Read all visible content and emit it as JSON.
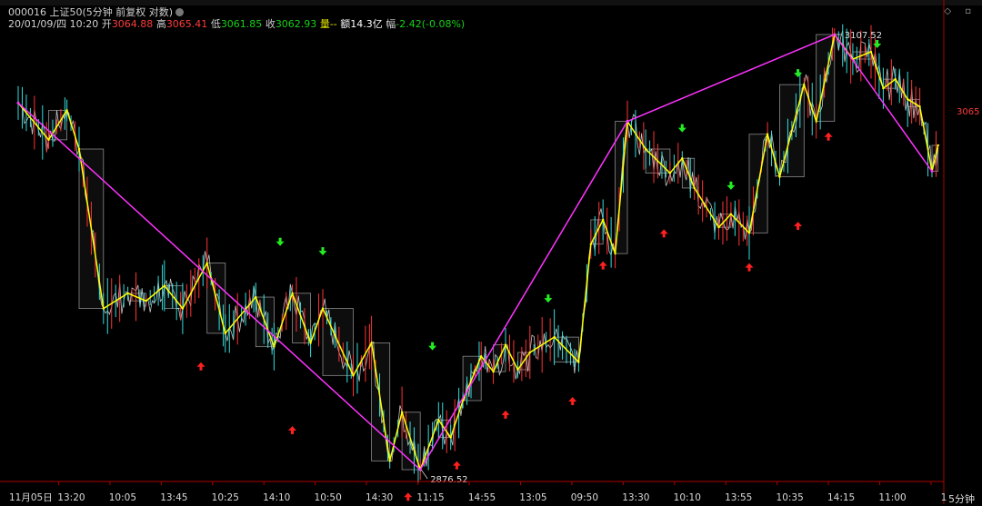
{
  "header": {
    "code": "000016",
    "name": "上证50",
    "mode": "(5分钟 前复权 对数)",
    "datetime": "20/01/09/四 10:20",
    "open_label": "开",
    "open": "3064.88",
    "high_label": "高",
    "high": "3065.41",
    "low_label": "低",
    "low": "3061.85",
    "close_label": "收",
    "close": "3062.93",
    "volume_label": "量",
    "volume": "--",
    "amount_label": "额",
    "amount": "14.3亿",
    "change_label": "幅",
    "change": "-2.42(-0.08%)"
  },
  "period_label": "5分钟",
  "colors": {
    "price_line": "#e8e8e8",
    "zigzag_small": "#ffff00",
    "zigzag_large": "#ff33ff",
    "up_arrow": "#ff2020",
    "down_arrow": "#22ee22",
    "box": "#8a8a8a"
  },
  "chart_data": {
    "type": "line",
    "x_tick_labels": [
      "11月05日",
      "13:20",
      "10:05",
      "13:45",
      "10:25",
      "14:10",
      "10:50",
      "14:30",
      "11:15",
      "14:55",
      "13:05",
      "09:50",
      "13:30",
      "10:10",
      "13:55",
      "10:35",
      "14:15",
      "11:00",
      "1"
    ],
    "price_scale": {
      "max": 3107.52,
      "min": 2876.52,
      "log": true
    },
    "current_price_label": "3065",
    "annotations": [
      {
        "label": "3107.52",
        "kind": "high"
      },
      {
        "label": "2876.52",
        "kind": "low"
      }
    ],
    "large_zigzag": [
      {
        "i": 0,
        "p": 3070
      },
      {
        "i": 66,
        "p": 2876.52
      },
      {
        "i": 100,
        "p": 3060
      },
      {
        "i": 134,
        "p": 3107.52
      },
      {
        "i": 150,
        "p": 3033
      }
    ],
    "small_zigzag": [
      {
        "i": 0,
        "p": 3070
      },
      {
        "i": 5,
        "p": 3050
      },
      {
        "i": 8,
        "p": 3066
      },
      {
        "i": 10,
        "p": 3045
      },
      {
        "i": 14,
        "p": 2960
      },
      {
        "i": 18,
        "p": 2968
      },
      {
        "i": 21,
        "p": 2964
      },
      {
        "i": 24,
        "p": 2972
      },
      {
        "i": 27,
        "p": 2960
      },
      {
        "i": 31,
        "p": 2984
      },
      {
        "i": 34,
        "p": 2947
      },
      {
        "i": 39,
        "p": 2966
      },
      {
        "i": 42,
        "p": 2940
      },
      {
        "i": 45,
        "p": 2968
      },
      {
        "i": 48,
        "p": 2942
      },
      {
        "i": 50,
        "p": 2960
      },
      {
        "i": 55,
        "p": 2925
      },
      {
        "i": 58,
        "p": 2942
      },
      {
        "i": 61,
        "p": 2881
      },
      {
        "i": 63,
        "p": 2906
      },
      {
        "i": 66,
        "p": 2876.52
      },
      {
        "i": 69,
        "p": 2902
      },
      {
        "i": 71,
        "p": 2893
      },
      {
        "i": 73,
        "p": 2912
      },
      {
        "i": 76,
        "p": 2935
      },
      {
        "i": 78,
        "p": 2927
      },
      {
        "i": 80,
        "p": 2941
      },
      {
        "i": 82,
        "p": 2928
      },
      {
        "i": 84,
        "p": 2937
      },
      {
        "i": 88,
        "p": 2945
      },
      {
        "i": 92,
        "p": 2932
      },
      {
        "i": 94,
        "p": 2994
      },
      {
        "i": 96,
        "p": 3007
      },
      {
        "i": 98,
        "p": 2989
      },
      {
        "i": 100,
        "p": 3060
      },
      {
        "i": 103,
        "p": 3045
      },
      {
        "i": 107,
        "p": 3032
      },
      {
        "i": 109,
        "p": 3040
      },
      {
        "i": 111,
        "p": 3024
      },
      {
        "i": 115,
        "p": 3003
      },
      {
        "i": 117,
        "p": 3010
      },
      {
        "i": 120,
        "p": 3000
      },
      {
        "i": 123,
        "p": 3053
      },
      {
        "i": 125,
        "p": 3030
      },
      {
        "i": 129,
        "p": 3080
      },
      {
        "i": 131,
        "p": 3060
      },
      {
        "i": 134,
        "p": 3107.52
      },
      {
        "i": 137,
        "p": 3094
      },
      {
        "i": 140,
        "p": 3098
      },
      {
        "i": 142,
        "p": 3078
      },
      {
        "i": 144,
        "p": 3083
      },
      {
        "i": 146,
        "p": 3072
      },
      {
        "i": 148,
        "p": 3068
      },
      {
        "i": 150,
        "p": 3033
      },
      {
        "i": 151,
        "p": 3047
      }
    ],
    "down_signals": [
      {
        "i": 43,
        "p": 2995
      },
      {
        "i": 50,
        "p": 2990
      },
      {
        "i": 68,
        "p": 2940
      },
      {
        "i": 87,
        "p": 2965
      },
      {
        "i": 109,
        "p": 3056
      },
      {
        "i": 117,
        "p": 3025
      },
      {
        "i": 128,
        "p": 3086
      },
      {
        "i": 141,
        "p": 3102
      }
    ],
    "up_signals": [
      {
        "i": 30,
        "p": 2930
      },
      {
        "i": 45,
        "p": 2897
      },
      {
        "i": 64,
        "p": 2863
      },
      {
        "i": 72,
        "p": 2879
      },
      {
        "i": 80,
        "p": 2905
      },
      {
        "i": 91,
        "p": 2912
      },
      {
        "i": 96,
        "p": 2983
      },
      {
        "i": 106,
        "p": 3000
      },
      {
        "i": 120,
        "p": 2982
      },
      {
        "i": 128,
        "p": 3004
      },
      {
        "i": 133,
        "p": 3052
      }
    ]
  }
}
